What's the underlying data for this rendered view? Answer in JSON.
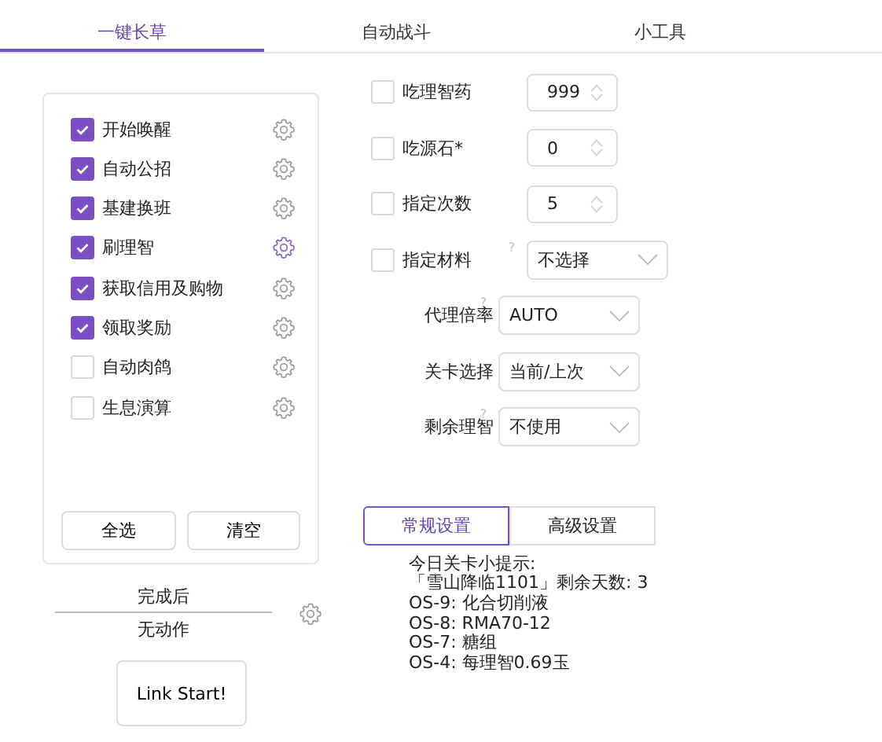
{
  "tabs": [
    {
      "label": "一键长草",
      "selected": true
    },
    {
      "label": "自动战斗",
      "selected": false
    },
    {
      "label": "小工具",
      "selected": false
    }
  ],
  "tasks": [
    {
      "label": "开始唤醒",
      "checked": true,
      "selected": false
    },
    {
      "label": "自动公招",
      "checked": true,
      "selected": false
    },
    {
      "label": "基建换班",
      "checked": true,
      "selected": false
    },
    {
      "label": "刷理智",
      "checked": true,
      "selected": true
    },
    {
      "label": "获取信用及购物",
      "checked": true,
      "selected": false
    },
    {
      "label": "领取奖励",
      "checked": true,
      "selected": false
    },
    {
      "label": "自动肉鸽",
      "checked": false,
      "selected": false
    },
    {
      "label": "生息演算",
      "checked": false,
      "selected": false
    }
  ],
  "task_buttons": [
    "全选",
    "清空"
  ],
  "after_finish": {
    "label": "完成后",
    "value": "无动作"
  },
  "start_button": "Link Start!",
  "options": [
    {
      "kind": "spinner",
      "label": "吃理智药",
      "checked": false,
      "value": "999"
    },
    {
      "kind": "spinner",
      "label": "吃源石*",
      "checked": false,
      "value": "0"
    },
    {
      "kind": "spinner",
      "label": "指定次数",
      "checked": false,
      "value": "5"
    },
    {
      "kind": "check-select",
      "label": "指定材料",
      "checked": false,
      "value": "不选择",
      "help": "?"
    },
    {
      "kind": "select",
      "label": "代理倍率",
      "value": "AUTO",
      "help": "?"
    },
    {
      "kind": "select",
      "label": "关卡选择",
      "value": "当前/上次"
    },
    {
      "kind": "select",
      "label": "剩余理智",
      "value": "不使用",
      "help": "?"
    }
  ],
  "settings_tabs": [
    {
      "label": "常规设置",
      "selected": true
    },
    {
      "label": "高级设置",
      "selected": false
    }
  ],
  "tips": [
    "今日关卡小提示:",
    "「雪山降临1101」剩余天数: 3",
    "OS-9: 化合切削液",
    "OS-8: RMA70-12",
    "OS-7: 糖组",
    "OS-4: 每理智0.69玉"
  ]
}
